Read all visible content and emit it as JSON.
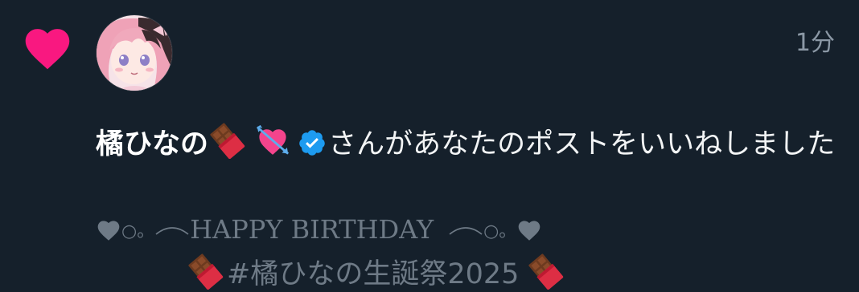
{
  "notification": {
    "timestamp": "1分",
    "user_name": "橘ひなの",
    "action_text": "さんがあなたのポストをいいねしました",
    "name_emojis": [
      "chocolate-bar-icon",
      "heart-with-arrow-icon"
    ],
    "verified": true
  },
  "tweet_preview": {
    "line1_deco_left": "○。",
    "line1_text": "HAPPY BIRTHDAY",
    "line1_deco_right": "○。",
    "line2_text": "#橘ひなの生誕祭2025"
  },
  "colors": {
    "background": "#15202b",
    "like_heart": "#f91880",
    "verified_badge": "#1d9bf0",
    "muted_text": "#6e7a86"
  }
}
